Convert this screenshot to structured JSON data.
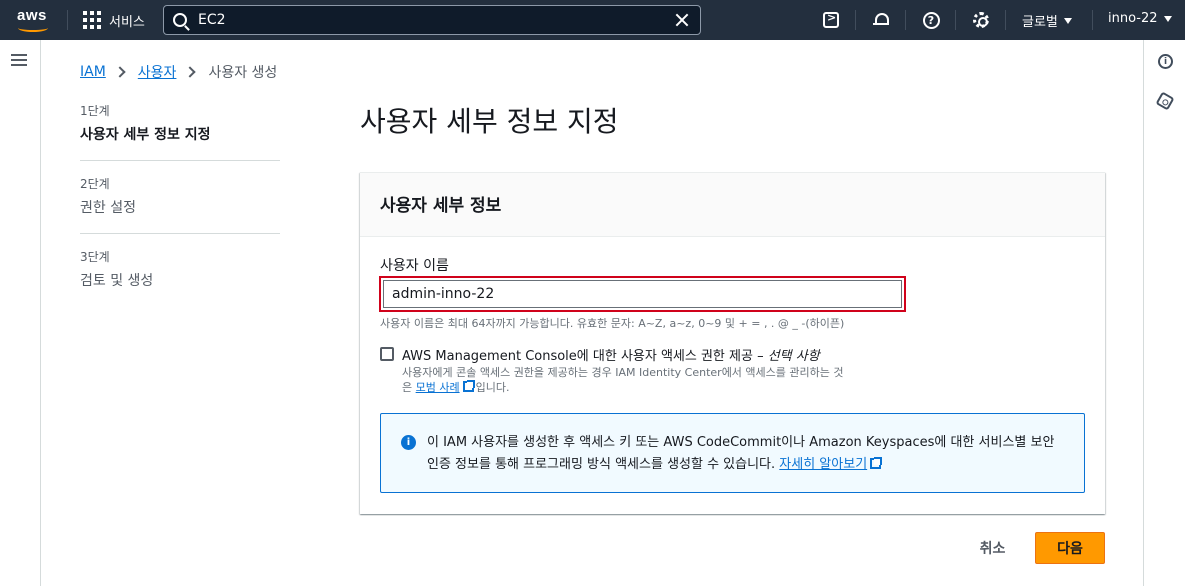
{
  "topnav": {
    "logo": "aws",
    "services_label": "서비스",
    "search_value": "EC2",
    "region_label": "글로벌",
    "account_label": "inno-22",
    "help_glyph": "?",
    "colors": {
      "bg": "#232f3e",
      "accent": "#ff9900"
    }
  },
  "breadcrumb": {
    "items": [
      "IAM",
      "사용자"
    ],
    "current": "사용자 생성"
  },
  "steps": [
    {
      "num": "1단계",
      "title": "사용자 세부 정보 지정",
      "active": true
    },
    {
      "num": "2단계",
      "title": "권한 설정",
      "active": false
    },
    {
      "num": "3단계",
      "title": "검토 및 생성",
      "active": false
    }
  ],
  "page_title": "사용자 세부 정보 지정",
  "panel": {
    "title": "사용자 세부 정보",
    "username_label": "사용자 이름",
    "username_value": "admin-inno-22",
    "username_constraint": "사용자 이름은 최대 64자까지 가능합니다. 유효한 문자: A~Z, a~z, 0~9 및 + = , . @ _ -(하이픈)",
    "console_checkbox_label": "AWS Management Console에 대한 사용자 액세스 권한 제공 – ",
    "console_checkbox_optional": "선택 사항",
    "console_checked": false,
    "console_desc_line1": "사용자에게 콘솔 액세스 권한을 제공하는 경우 IAM Identity Center에서 액세스를 관리하는 것",
    "console_desc_prefix": "은 ",
    "console_desc_link": "모범 사례",
    "console_desc_suffix": "입니다.",
    "info_text": "이 IAM 사용자를 생성한 후 액세스 키 또는 AWS CodeCommit이나 Amazon Keyspaces에 대한 서비스별 보안 인증 정보를 통해 프로그래밍 방식 액세스를 생성할 수 있습니다. ",
    "info_link": "자세히 알아보기",
    "info_glyph": "i",
    "colors": {
      "link": "#0972d3",
      "highlight_border": "#d0021b",
      "info_bg": "#f1faff"
    }
  },
  "footer": {
    "cancel_label": "취소",
    "next_label": "다음",
    "colors": {
      "primary": "#ff9900"
    }
  }
}
